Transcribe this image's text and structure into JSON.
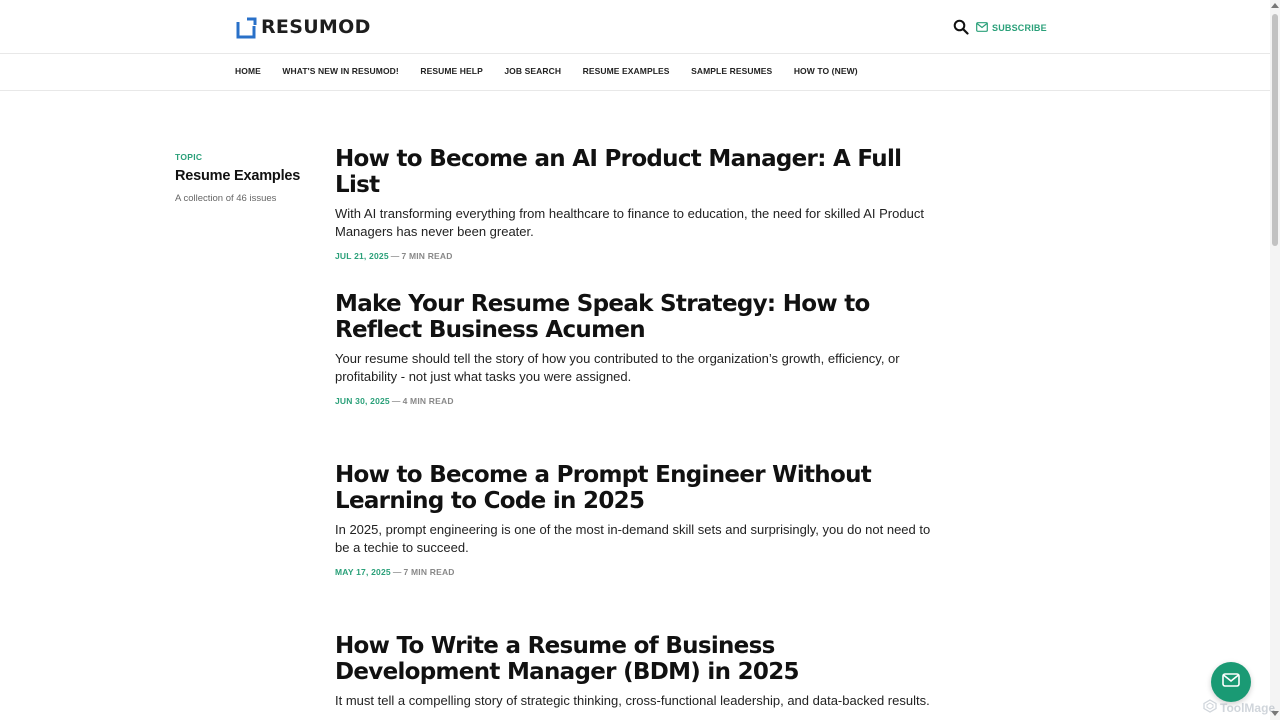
{
  "header": {
    "logo_text": "RESUMOD",
    "subscribe_label": "SUBSCRIBE",
    "accent_color": "#2aa079",
    "logo_color": "#2970c8"
  },
  "nav": {
    "items": [
      {
        "label": "HOME"
      },
      {
        "label": "WHAT'S NEW IN RESUMOD!"
      },
      {
        "label": "RESUME HELP"
      },
      {
        "label": "JOB SEARCH"
      },
      {
        "label": "RESUME EXAMPLES"
      },
      {
        "label": "SAMPLE RESUMES"
      },
      {
        "label": "HOW TO (NEW)"
      }
    ]
  },
  "topic": {
    "kicker": "TOPIC",
    "title": "Resume Examples",
    "count": "A collection of 46 issues"
  },
  "articles": [
    {
      "title": "How to Become an AI Product Manager: A Full List",
      "excerpt": "With AI transforming everything from healthcare to finance to education, the need for skilled AI Product Managers has never been greater.",
      "date": "JUL 21, 2025",
      "separator": "—",
      "read_time": "7 MIN READ"
    },
    {
      "title": "Make Your Resume Speak Strategy: How to Reflect Business Acumen",
      "excerpt": "Your resume should tell the story of how you contributed to the organization’s growth, efficiency, or profitability - not just what tasks you were assigned.",
      "date": "JUN 30, 2025",
      "separator": "—",
      "read_time": "4 MIN READ"
    },
    {
      "title": "How to Become a Prompt Engineer Without Learning to Code in 2025",
      "excerpt": "In 2025, prompt engineering is one of the most in-demand skill sets and surprisingly, you do not need to be a techie to succeed.",
      "date": "MAY 17, 2025",
      "separator": "—",
      "read_time": "7 MIN READ"
    },
    {
      "title": "How To Write a Resume of Business Development Manager (BDM) in 2025",
      "excerpt": "It must tell a compelling story of strategic thinking, cross-functional leadership, and data-backed results.",
      "date": "",
      "separator": "",
      "read_time": ""
    }
  ],
  "watermark": {
    "text": "ToolMage"
  },
  "icons": {
    "search": "search-icon",
    "subscribe": "mail-icon",
    "fab": "mail-icon"
  }
}
